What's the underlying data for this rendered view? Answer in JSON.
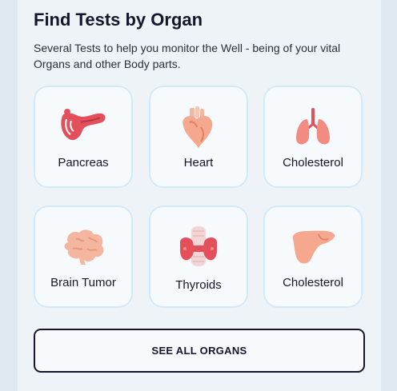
{
  "section": {
    "title": "Find Tests by Organ",
    "description": "Several Tests to help you monitor the Well - being of your vital Organs and other Body parts."
  },
  "organs": [
    {
      "label": "Pancreas",
      "icon": "pancreas-icon"
    },
    {
      "label": "Heart",
      "icon": "heart-icon"
    },
    {
      "label": "Cholesterol",
      "icon": "lungs-icon"
    },
    {
      "label": "Brain Tumor",
      "icon": "brain-icon"
    },
    {
      "label": "Thyroids",
      "icon": "thyroid-icon"
    },
    {
      "label": "Cholesterol",
      "icon": "liver-icon"
    }
  ],
  "footer": {
    "see_all_label": "SEE ALL ORGANS"
  },
  "colors": {
    "title": "#14172b",
    "card_border": "#d3e9f7",
    "card_background": "#f7fafd",
    "organ_red": "#e3505b",
    "organ_peach": "#f5a88e",
    "button_border": "#14172b"
  }
}
